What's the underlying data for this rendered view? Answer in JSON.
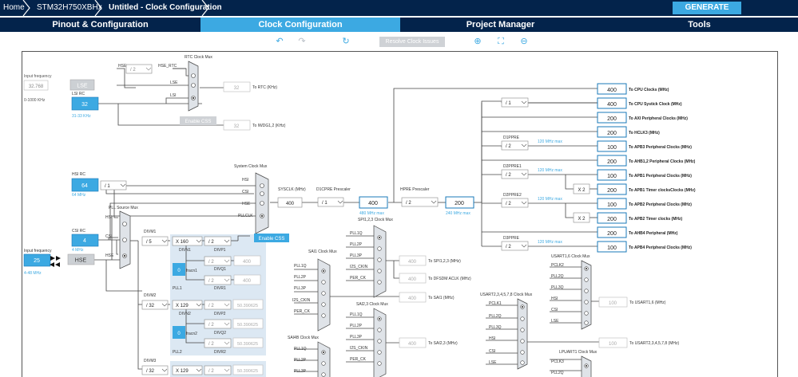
{
  "breadcrumb": {
    "home": "Home",
    "mcu": "STM32H750XBHx",
    "project": "Untitled - Clock Configuration"
  },
  "header": {
    "generate": "GENERATE CODE"
  },
  "tabs": [
    "Pinout & Configuration",
    "Clock Configuration",
    "Project Manager",
    "Tools"
  ],
  "toolbar": {
    "resolve": "Resolve Clock Issues"
  },
  "left": {
    "input_freq_top_label": "Input frequency",
    "input_freq_top_value": "32.768",
    "input_freq_top_range": "0-1000 KHz",
    "lse": "LSE",
    "lsi_rc": "LSI RC",
    "lsi_val": "32",
    "lsi_range": "31-33 KHz",
    "hsi_rc": "HSI RC",
    "hsi_val": "64",
    "hsi_freq": "64 MHz",
    "csi_rc": "CSI RC",
    "csi_val": "4",
    "csi_freq": "4 MHz",
    "input_freq_bottom_label": "Input frequency",
    "input_freq_bottom_value": "25",
    "input_freq_bottom_range": "4-48 MHz",
    "hse": "HSE",
    "hsi_div": "/ 1"
  },
  "rtc": {
    "mux_title": "RTC Clock Mux",
    "hse_label": "HSE",
    "hse_div": "/ 2",
    "hse_rtc": "HSE_RTC",
    "lse_label": "LSE",
    "lsi_label": "LSI",
    "out_val": "32",
    "out_label": "To RTC (KHz)",
    "enable_css": "Enable CSS",
    "iwdg_val": "32",
    "iwdg_label": "To IWDG1,2 (KHz)"
  },
  "sysmux": {
    "title": "System Clock Mux",
    "hsi": "HSI",
    "csi": "CSI",
    "hse": "HSE",
    "pllclk": "PLLCLK",
    "enable_css": "Enable CSS",
    "sysclk_label": "SYSCLK (MHz)",
    "sysclk_val": "400",
    "d1cpre_label": "D1CPRE Prescaler",
    "d1cpre_val": "/ 1",
    "cpu_val": "400",
    "cpu_max": "480 MHz max",
    "hpre_label": "HPRE Prescaler",
    "hpre_val": "/ 2",
    "hclk_val": "200",
    "hclk_max": "240 MHz max"
  },
  "pll": {
    "mux_title": "PLL Source Mux",
    "hsi": "HSI",
    "csi": "CSI",
    "hse": "HSE",
    "divm1": "DIVM1",
    "divm1_val": "/ 5",
    "divn1": "DIVN1",
    "divn1_val": "X 160",
    "divp1": "DIVP1",
    "divp1_val": "/ 2",
    "divq1": "DIVQ1",
    "divq1_val": "/ 2",
    "divq1_out": "400",
    "divr1": "DIVR1",
    "divr1_val": "/ 2",
    "divr1_out": "400",
    "fracn1_val": "0",
    "fracn1": "fracn1",
    "pll1": "PLL1",
    "divm2": "DIVM2",
    "divm2_val": "/ 32",
    "divn2": "DIVN2",
    "divn2_val": "X 129",
    "divp2": "DIVP2",
    "divp2_val": "/ 2",
    "divp2_out": "50.390625",
    "divq2": "DIVQ2",
    "divq2_val": "/ 2",
    "divq2_out": "50.390625",
    "divr2": "DIVR2",
    "divr2_val": "/ 2",
    "divr2_out": "50.390625",
    "fracn2_val": "0",
    "fracn2": "fracn2",
    "pll2": "PLL2",
    "divm3": "DIVM3",
    "divm3_val": "/ 32",
    "divn3_val": "X 129",
    "divp3_val": "/ 2",
    "divp3_out": "50.390625"
  },
  "spi": {
    "spi123_mux": "SPI1,2,3 Clock Mux",
    "spi_in": [
      "PLL1Q",
      "PLL2P",
      "PLL3P",
      "I2S_CKIN",
      "PER_CK"
    ],
    "spi_val": "400",
    "spi_label": "To SPI1,2,3 (MHz)",
    "dfsdm_val": "400",
    "dfsdm_label": "To DFSDM ACLK (MHz)",
    "sai1_mux": "SAI1 Clock Mux",
    "sai1_in": [
      "PLL1Q",
      "PLL2P",
      "PLL3P",
      "I2S_CKIN",
      "PER_CK"
    ],
    "sai1_val": "400",
    "sai1_label": "To SAI1 (MHz)",
    "sai23_mux": "SAI2,3 Clock Mux",
    "sai23_in": [
      "PLL1Q",
      "PLL2P",
      "PLL3P",
      "I2S_CKIN",
      "PER_CK"
    ],
    "sai23_val": "400",
    "sai23_label": "To SAI2,3 (MHz)",
    "sai4b_mux": "SAI4B Clock Mux",
    "sai4b_in": [
      "PLL1Q",
      "PLL2P",
      "PLL3P"
    ]
  },
  "usart": {
    "usart16_mux": "USART1,6 Clock Mux",
    "usart16_in": [
      "PCLK2",
      "PLL2Q",
      "PLL3Q",
      "HSI",
      "CSI",
      "LSE"
    ],
    "usart16_val": "100",
    "usart16_label": "To USART1,6 (MHz)",
    "usart2_mux": "USART2,3,4,5,7,8 Clock Mux",
    "usart2_in": [
      "PCLK1",
      "PLL2Q",
      "PLL3Q",
      "HSI",
      "CSI",
      "LSE"
    ],
    "usart2_val": "100",
    "usart2_label": "To USART2,3,4,5,7,8 (MHz)",
    "lpuart_mux": "LPUART1 Clock Mux",
    "lpuart_in": [
      "PCLK3",
      "PLL2Q"
    ]
  },
  "outputs": {
    "cpu_clocks_val": "400",
    "cpu_clocks_label": "To CPU Clocks (MHz)",
    "systick_div": "/ 1",
    "systick_val": "400",
    "systick_label": "To CPU Systick Clock (MHz)",
    "axi_val": "200",
    "axi_label": "To AXI Peripheral Clocks (MHz)",
    "hclk3_val": "200",
    "hclk3_label": "To HCLK3 (MHz)",
    "d1ppre": "D1PPRE",
    "d1ppre_div": "/ 2",
    "d1ppre_max": "120 MHz max",
    "apb3_val": "100",
    "apb3_label": "To APB3 Peripheral Clocks (MHz)",
    "ahb12_val": "200",
    "ahb12_label": "To AHB1,2 Peripheral Clocks (MHz)",
    "d2ppre1": "D2PPRE1",
    "d2ppre1_div": "/ 2",
    "d2ppre1_max": "120 MHz max",
    "apb1_val": "100",
    "apb1_label": "To APB1 Peripheral Clocks (MHz)",
    "x2_1": "X 2",
    "apb1t_val": "200",
    "apb1t_label": "To APB1 Timer clocksClocks (MHz)",
    "d2ppre2": "D2PPRE2",
    "d2ppre2_div": "/ 2",
    "d2ppre2_max": "120 MHz max",
    "apb2_val": "100",
    "apb2_label": "To APB2 Peripheral Clocks (MHz)",
    "x2_2": "X 2",
    "apb2t_val": "200",
    "apb2t_label": "To APB2 Timer clocks (MHz)",
    "ahb4_val": "200",
    "ahb4_label": "To AHB4 Peripheral (MHz)",
    "d3ppre": "D3PPRE",
    "d3ppre_div": "/ 2",
    "d3ppre_max": "120 MHz max",
    "apb4_val": "100",
    "apb4_label": "To APB4 Peripheral Clocks (MHz)"
  },
  "colors": {
    "navy": "#03234b",
    "accent": "#3ca9e2",
    "panel": "#dce8f3"
  }
}
